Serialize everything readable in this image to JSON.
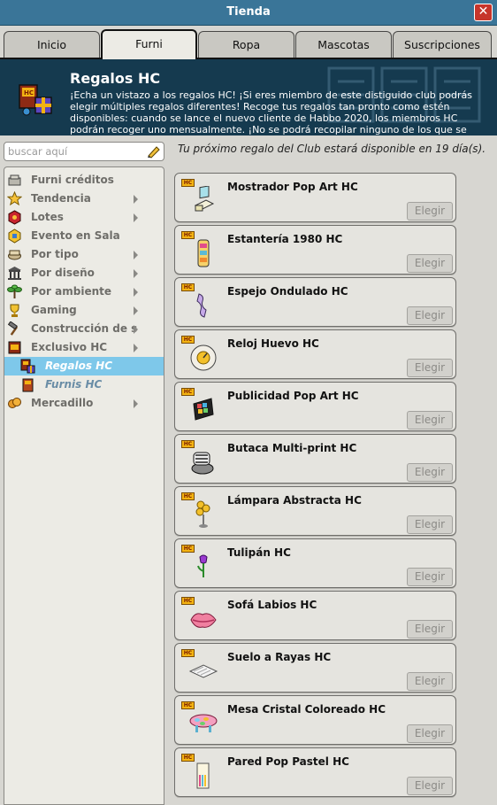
{
  "window": {
    "title": "Tienda",
    "close_symbol": "✕"
  },
  "tabs": [
    {
      "label": "Inicio"
    },
    {
      "label": "Furni"
    },
    {
      "label": "Ropa"
    },
    {
      "label": "Mascotas"
    },
    {
      "label": "Suscripciones"
    }
  ],
  "header": {
    "title": "Regalos HC",
    "description": "¡Echa un vistazo a los regalos HC! ¡Si eres miembro de este distiguido club podrás elegir múltiples regalos diferentes! Recoge tus regalos tan pronto como estén disponibles: cuando se lance el nuevo cliente de Habbo 2020, los miembros HC podrán recoger uno mensualmente. ¡No se podrá recopilar ninguno de los que se"
  },
  "search": {
    "placeholder": "buscar aquí"
  },
  "categories": [
    {
      "label": "Furni créditos",
      "icon": "credits-furni-icon",
      "has_arrow": false
    },
    {
      "label": "Tendencia",
      "icon": "star-icon",
      "has_arrow": true
    },
    {
      "label": "Lotes",
      "icon": "bundle-icon",
      "has_arrow": true
    },
    {
      "label": "Evento en Sala",
      "icon": "event-icon",
      "has_arrow": false
    },
    {
      "label": "Por tipo",
      "icon": "type-icon",
      "has_arrow": true
    },
    {
      "label": "Por diseño",
      "icon": "design-icon",
      "has_arrow": true
    },
    {
      "label": "Por ambiente",
      "icon": "plant-icon",
      "has_arrow": true
    },
    {
      "label": "Gaming",
      "icon": "trophy-icon",
      "has_arrow": true
    },
    {
      "label": "Construcción de salas",
      "icon": "hammer-icon",
      "has_arrow": true
    },
    {
      "label": "Exclusivo HC",
      "icon": "hc-icon",
      "has_arrow": true
    },
    {
      "label": "Regalos HC",
      "icon": "hc-gift-icon",
      "has_arrow": false,
      "sub": true,
      "selected": true
    },
    {
      "label": "Furnis HC",
      "icon": "hc-furni-icon",
      "has_arrow": false,
      "sub": true
    },
    {
      "label": "Mercadillo",
      "icon": "marketplace-icon",
      "has_arrow": true
    }
  ],
  "notice": "Tu próximo regalo del Club estará disponible en 19 día(s).",
  "gifts": [
    {
      "name": "Mostrador Pop Art HC",
      "icon": "counter-icon"
    },
    {
      "name": "Estantería 1980 HC",
      "icon": "shelf-icon"
    },
    {
      "name": "Espejo Ondulado HC",
      "icon": "mirror-icon"
    },
    {
      "name": "Reloj Huevo HC",
      "icon": "clock-icon"
    },
    {
      "name": "Publicidad Pop Art HC",
      "icon": "billboard-icon"
    },
    {
      "name": "Butaca Multi-print HC",
      "icon": "armchair-icon"
    },
    {
      "name": "Lámpara Abstracta HC",
      "icon": "lamp-icon"
    },
    {
      "name": "Tulipán HC",
      "icon": "tulip-icon"
    },
    {
      "name": "Sofá Labios HC",
      "icon": "lips-sofa-icon"
    },
    {
      "name": "Suelo a Rayas HC",
      "icon": "floor-icon"
    },
    {
      "name": "Mesa Cristal Coloreado HC",
      "icon": "table-icon"
    },
    {
      "name": "Pared Pop Pastel HC",
      "icon": "wall-icon"
    }
  ],
  "gift_badge": "HC",
  "choose_label": "Elegir",
  "colors": {
    "titlebar": "#3a7598",
    "header": "#153a4f",
    "selected": "#7ec8ea",
    "hc_badge": "#f3b312",
    "close": "#c6352b"
  }
}
